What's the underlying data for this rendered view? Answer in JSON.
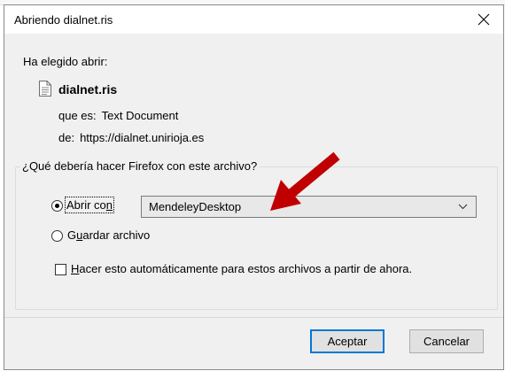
{
  "window": {
    "title": "Abriendo dialnet.ris"
  },
  "intro": {
    "chosen_label": "Ha elegido abrir:"
  },
  "file": {
    "name": "dialnet.ris",
    "type_label": "que es:",
    "type_value": "Text Document",
    "from_label": "de:",
    "from_value": "https://dialnet.unirioja.es"
  },
  "action_group": {
    "legend": "¿Qué debería hacer Firefox con este archivo?",
    "open_with": {
      "label_pre": "Abrir co",
      "label_access": "n",
      "selected": true
    },
    "app_select": {
      "value": "MendeleyDesktop"
    },
    "save_file": {
      "label_pre": "G",
      "label_access": "u",
      "label_post": "ardar archivo",
      "selected": false
    },
    "auto": {
      "label_access": "H",
      "label_post": "acer esto automáticamente para estos archivos a partir de ahora.",
      "checked": false
    }
  },
  "buttons": {
    "accept": "Aceptar",
    "cancel": "Cancelar"
  },
  "colors": {
    "arrow": "#c00000",
    "default_button_border": "#0078d7",
    "dialog_bg": "#f0f0f0"
  }
}
